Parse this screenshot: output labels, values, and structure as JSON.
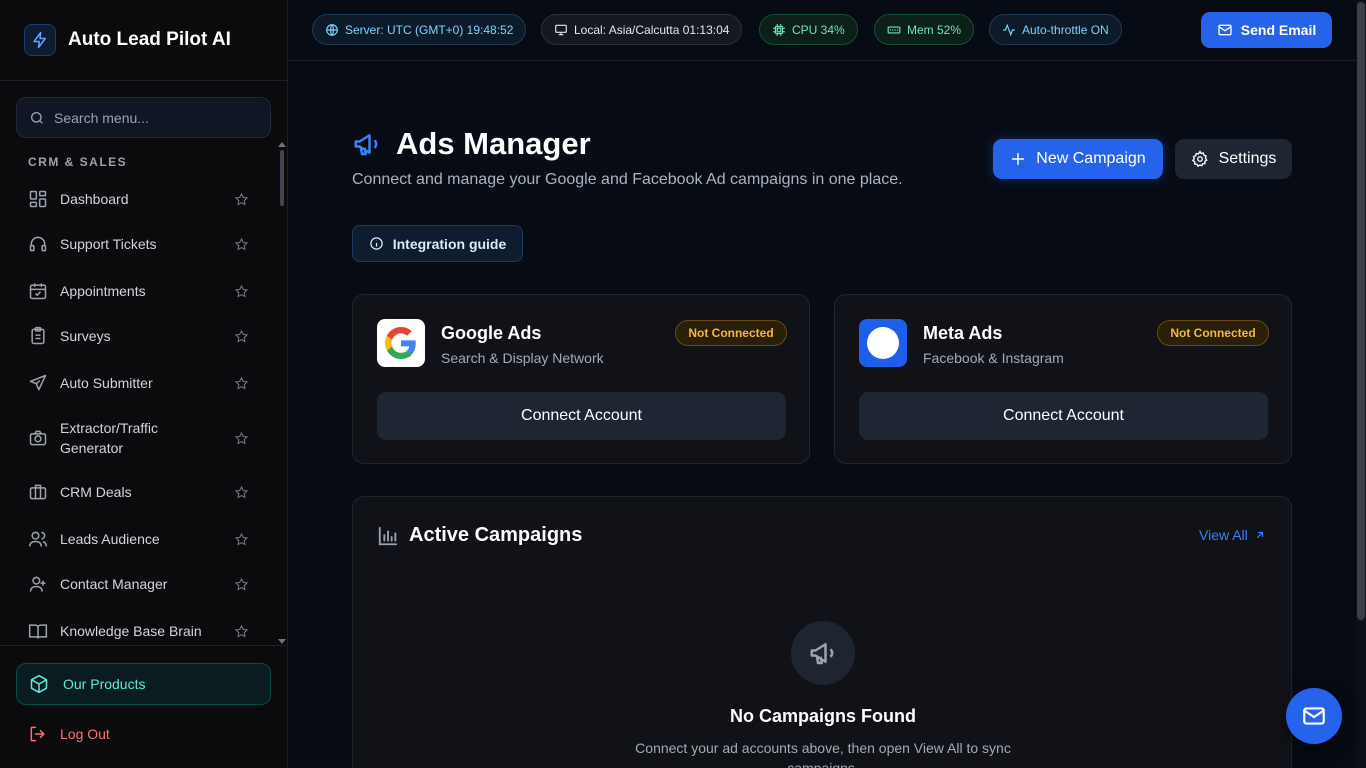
{
  "brand": {
    "name": "Auto Lead Pilot AI"
  },
  "sidebar": {
    "search_placeholder": "Search menu...",
    "section": "CRM & SALES",
    "items": [
      {
        "label": "Dashboard",
        "icon": "dashboard-icon"
      },
      {
        "label": "Support Tickets",
        "icon": "headset-icon"
      },
      {
        "label": "Appointments",
        "icon": "calendar-check-icon"
      },
      {
        "label": "Surveys",
        "icon": "clipboard-icon"
      },
      {
        "label": "Auto Submitter",
        "icon": "send-icon"
      },
      {
        "label": "Extractor/Traffic Generator",
        "icon": "camera-icon"
      },
      {
        "label": "CRM Deals",
        "icon": "briefcase-icon"
      },
      {
        "label": "Leads Audience",
        "icon": "users-icon"
      },
      {
        "label": "Contact Manager",
        "icon": "user-group-icon"
      },
      {
        "label": "Knowledge Base Brain",
        "icon": "book-icon"
      }
    ],
    "products_label": "Our Products",
    "logout_label": "Log Out"
  },
  "topbar": {
    "server_time": "Server: UTC (GMT+0) 19:48:52",
    "local_time": "Local: Asia/Calcutta 01:13:04",
    "cpu": "CPU 34%",
    "mem": "Mem 52%",
    "throttle": "Auto-throttle ON",
    "send_email": "Send Email"
  },
  "main": {
    "title": "Ads Manager",
    "subtitle": "Connect and manage your Google and Facebook Ad campaigns in one place.",
    "new_campaign": "New Campaign",
    "settings": "Settings",
    "integration_guide": "Integration guide",
    "cards": [
      {
        "name": "Google Ads",
        "sub": "Search & Display Network",
        "status": "Not Connected",
        "action": "Connect Account"
      },
      {
        "name": "Meta Ads",
        "sub": "Facebook & Instagram",
        "status": "Not Connected",
        "action": "Connect Account"
      }
    ],
    "campaigns": {
      "title": "Active Campaigns",
      "view_all": "View All",
      "empty_title": "No Campaigns Found",
      "empty_sub": "Connect your ad accounts above, then open View All to sync campaigns."
    }
  },
  "colors": {
    "accent": "#2563eb",
    "warning": "#f5b83d",
    "teal": "#5eead4",
    "danger": "#f87171"
  }
}
